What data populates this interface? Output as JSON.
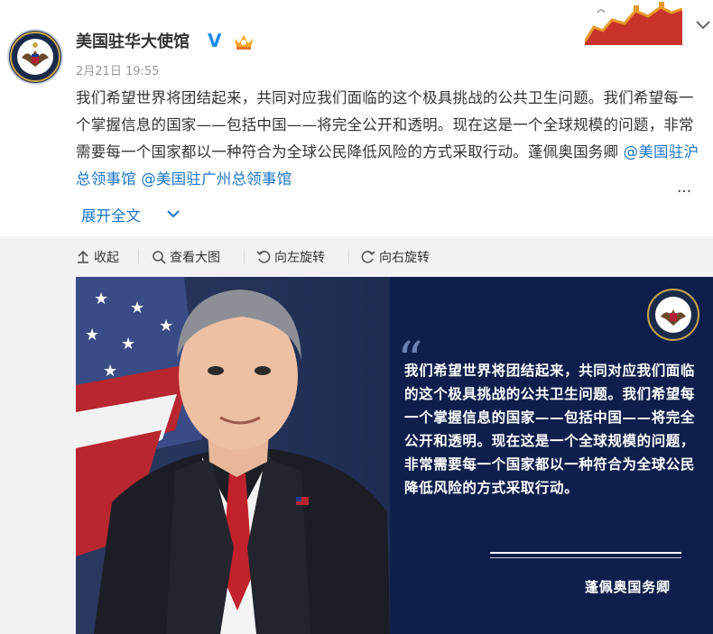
{
  "account": {
    "name": "美国驻华大使馆",
    "verified_mark": "V",
    "time": "2月21日 19:55"
  },
  "post": {
    "text_main": "我们希望世界将团结起来，共同对应我们面临的这个极具挑战的公共卫生问题。我们希望每一个掌握信息的国家——包括中国——将完全公开和透明。现在这是一个全球规模的问题，非常需要每一个国家都以一种符合为全球公民降低风险的方式采取行动。蓬佩奥国务卿 ",
    "mention_1": "@美国驻沪总领事馆",
    "mention_2": "@美国驻广州总领事馆",
    "ellipsis": "…",
    "expand_label": "展开全文"
  },
  "toolbar": {
    "collapse_label": "收起",
    "view_large_label": "查看大图",
    "rotate_left_label": "向左旋转",
    "rotate_right_label": "向右旋转"
  },
  "image": {
    "quote_open": "“",
    "quote": "我们希望世界将团结起来，共同对应我们面临的这个极具挑战的公共卫生问题。我们希望每一个掌握信息的国家——包括中国——将完全公开和透明。现在这是一个全球规模的问题，非常需要每一个国家都以一种符合为全球公民降低风险的方式采取行动。",
    "signature": "蓬佩奥国务卿"
  },
  "colors": {
    "link": "#1a75c9",
    "verified": "#1a8cf0",
    "image_navy": "#0f1f4d",
    "media_bg": "#f2f2f5"
  },
  "icons": [
    "seal-icon",
    "verified-icon",
    "crown-badge-icon",
    "great-wall-banner",
    "chevron-down-icon",
    "arrow-up-icon",
    "magnifier-icon",
    "rotate-left-icon",
    "rotate-right-icon"
  ]
}
